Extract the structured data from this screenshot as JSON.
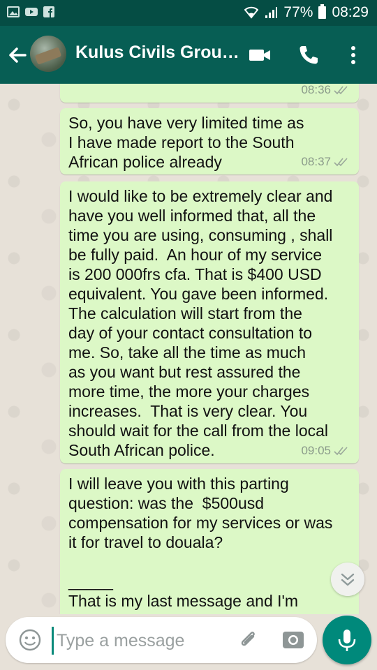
{
  "status_bar": {
    "battery": "77%",
    "time": "08:29",
    "icons": [
      "image-icon",
      "youtube-icon",
      "facebook-icon"
    ]
  },
  "header": {
    "title": "Kulus Civils Grou…",
    "icons": [
      "back-arrow-icon",
      "video-call-icon",
      "phone-icon",
      "more-vert-icon"
    ]
  },
  "messages": [
    {
      "text": "",
      "time": "08:36",
      "status": "read"
    },
    {
      "text": "So, you have very limited time as\nI have made report to the South\nAfrican police already",
      "time": "08:37",
      "status": "read"
    },
    {
      "text": "I would like to be extremely clear and\nhave you well informed that, all the\ntime you are using, consuming , shall\nbe fully paid.  An hour of my service\nis 200 000frs cfa. That is $400 USD\nequivalent. You gave been informed.\nThe calculation will start from the\nday of your contact consultation to\nme. So, take all the time as much\nas you want but rest assured the\nmore time, the more your charges\nincreases.  That is very clear. You\nshould wait for the call from the local\nSouth African police.",
      "time": "09:05",
      "status": "read"
    },
    {
      "text": "I will leave you with this parting\nquestion: was the  $500usd\ncompensation for my services or was\nit for travel to douala?\n\n_____\nThat is my last message and I'm\nexpecting to get the receipt of the",
      "time": "",
      "status": ""
    }
  ],
  "input": {
    "placeholder": "Type a message"
  },
  "colors": {
    "status_bar": "#054d44",
    "app_bar": "#075e54",
    "outgoing_bubble": "#dcf8c6",
    "fab": "#00897b"
  }
}
